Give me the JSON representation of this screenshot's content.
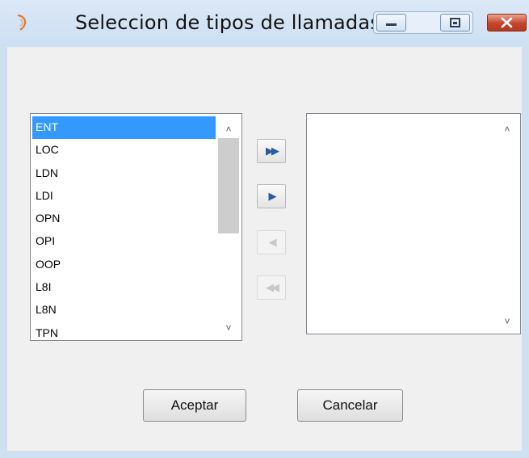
{
  "window": {
    "title": "Seleccion de tipos de llamadas",
    "controls": [
      "minimize-icon",
      "maximize-icon",
      "close-icon"
    ]
  },
  "available_list": {
    "items": [
      "ENT",
      "LOC",
      "LDN",
      "LDI",
      "OPN",
      "OPI",
      "OOP",
      "L8I",
      "L8N",
      "TPN"
    ],
    "selected_index": 0
  },
  "selected_list": {
    "items": []
  },
  "transfer_buttons": {
    "add_all": "▶▶",
    "add": "▶",
    "remove": "◀",
    "remove_all": "◀◀"
  },
  "footer": {
    "accept_label": "Aceptar",
    "cancel_label": "Cancelar"
  },
  "colors": {
    "selection": "#3399ff",
    "titlebar": "#cddff2",
    "client": "#f0f0f0"
  }
}
